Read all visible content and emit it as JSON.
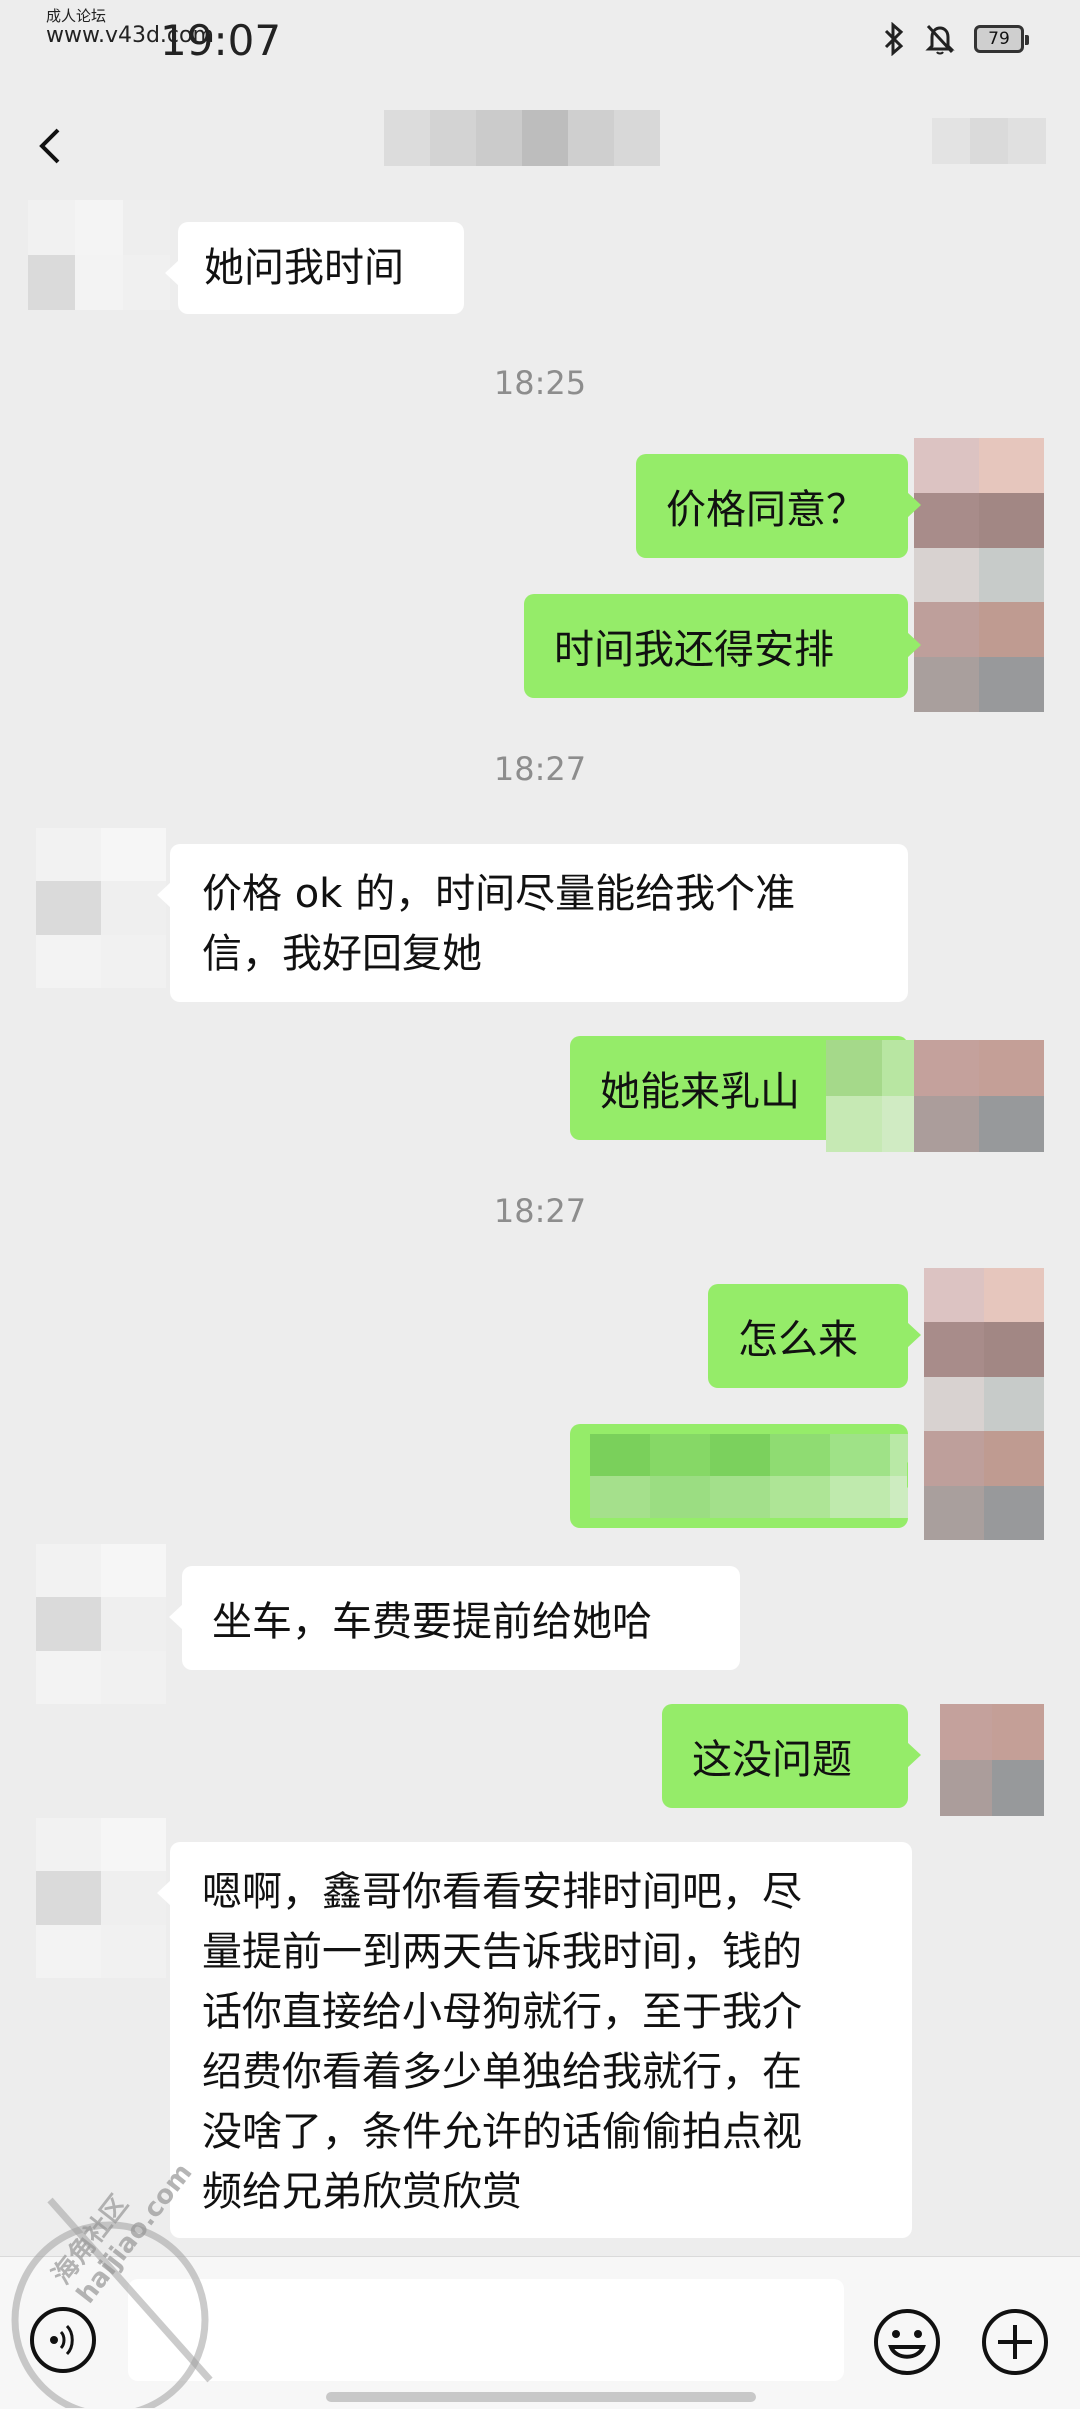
{
  "status_bar": {
    "watermark_line1": "成人论坛",
    "watermark_line2": "www.v43d.com",
    "time": "19:07",
    "battery": "79"
  },
  "chat": {
    "m1": "她问我时间",
    "t1": "18:25",
    "m2": "价格同意？",
    "m3": "时间我还得安排",
    "t2": "18:27",
    "m4_line1": "价格 ok 的，时间尽量能给我个准",
    "m4_line2": "信，我好回复她",
    "m5": "她能来乳山",
    "t3": "18:27",
    "m6": "怎么来",
    "m8": "坐车，车费要提前给她哈",
    "m9": "这没问题",
    "m10_lines": [
      "嗯啊，鑫哥你看看安排时间吧，尽",
      "量提前一到两天告诉我时间，钱的",
      "话你直接给小母狗就行，至于我介",
      "绍费你看着多少单独给我就行，在",
      "没啥了，条件允许的话偷偷拍点视",
      "频给兄弟欣赏欣赏"
    ]
  },
  "stamp": {
    "line1": "海角社区",
    "line2": "haijiao.com"
  },
  "icons": [
    "back-icon",
    "bluetooth-icon",
    "mute-bell-icon",
    "battery-icon",
    "voice-icon",
    "emoji-icon",
    "plus-icon"
  ],
  "colors": {
    "background": "#ededed",
    "incoming_bubble": "#ffffff",
    "outgoing_bubble": "#95ec69",
    "timestamp": "#8d8d8d"
  }
}
